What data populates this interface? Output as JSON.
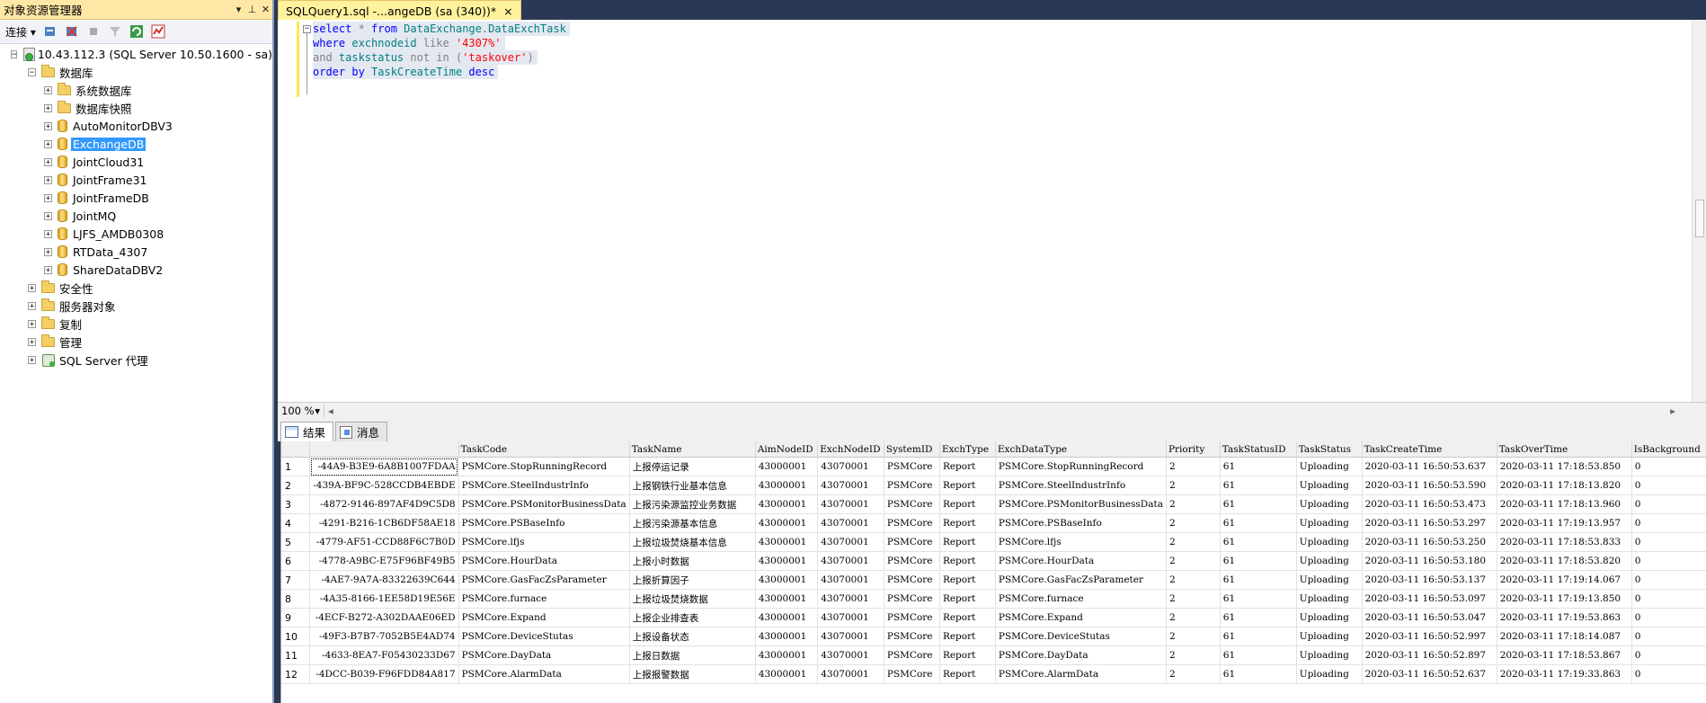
{
  "object_explorer": {
    "title": "对象资源管理器",
    "controls": [
      "▾",
      "⊥",
      "✕"
    ],
    "connect_label": "连接",
    "server": "10.43.112.3 (SQL Server 10.50.1600 - sa)",
    "databases_label": "数据库",
    "system_folders": [
      "系统数据库",
      "数据库快照"
    ],
    "databases": [
      "AutoMonitorDBV3",
      "ExchangeDB",
      "JointCloud31",
      "JointFrame31",
      "JointFrameDB",
      "JointMQ",
      "LJFS_AMDB0308",
      "RTData_4307",
      "ShareDataDBV2"
    ],
    "selected_database": "ExchangeDB",
    "server_folders": [
      "安全性",
      "服务器对象",
      "复制",
      "管理"
    ],
    "agent_label": "SQL Server 代理"
  },
  "document_tab": {
    "title": "SQLQuery1.sql -...angeDB (sa (340))*",
    "close": "×"
  },
  "editor": {
    "lines": [
      [
        {
          "t": "select",
          "c": "kw"
        },
        {
          "t": " * ",
          "c": "gr"
        },
        {
          "t": "from",
          "c": "kw"
        },
        {
          "t": " DataExchange",
          "c": "ob"
        },
        {
          "t": ".",
          "c": "gr"
        },
        {
          "t": "DataExchTask",
          "c": "ob"
        }
      ],
      [
        {
          "t": "where",
          "c": "kw"
        },
        {
          "t": " exchnodeid ",
          "c": "ob"
        },
        {
          "t": "like",
          "c": "gr"
        },
        {
          "t": " '4307%'",
          "c": "str"
        }
      ],
      [
        {
          "t": "and",
          "c": "gr"
        },
        {
          "t": " taskstatus ",
          "c": "ob"
        },
        {
          "t": "not in",
          "c": "gr"
        },
        {
          "t": " (",
          "c": "gr"
        },
        {
          "t": "'taskover'",
          "c": "str"
        },
        {
          "t": ")",
          "c": "gr"
        }
      ],
      [
        {
          "t": "order by",
          "c": "kw"
        },
        {
          "t": " TaskCreateTime ",
          "c": "ob"
        },
        {
          "t": "desc",
          "c": "kw"
        }
      ]
    ]
  },
  "zoom": {
    "value": "100 %"
  },
  "results": {
    "tabs": [
      "结果",
      "消息"
    ],
    "columns": [
      "",
      "",
      "TaskCode",
      "TaskName",
      "AimNodeID",
      "ExchNodeID",
      "SystemID",
      "ExchType",
      "ExchDataType",
      "Priority",
      "TaskStatusID",
      "TaskStatus",
      "TaskCreateTime",
      "TaskOverTime",
      "IsBackground"
    ],
    "rows": [
      [
        "1",
        "-44A9-B3E9-6A8B1007FDAA",
        "PSMCore.StopRunningRecord",
        "上报停运记录",
        "43000001",
        "43070001",
        "PSMCore",
        "Report",
        "PSMCore.StopRunningRecord",
        "2",
        "61",
        "Uploading",
        "2020-03-11 16:50:53.637",
        "2020-03-11 17:18:53.850",
        "0"
      ],
      [
        "2",
        "-439A-BF9C-528CCDB4EBDE",
        "PSMCore.SteelIndustrInfo",
        "上报钢铁行业基本信息",
        "43000001",
        "43070001",
        "PSMCore",
        "Report",
        "PSMCore.SteelIndustrInfo",
        "2",
        "61",
        "Uploading",
        "2020-03-11 16:50:53.590",
        "2020-03-11 17:18:13.820",
        "0"
      ],
      [
        "3",
        "-4872-9146-897AF4D9C5D8",
        "PSMCore.PSMonitorBusinessData",
        "上报污染源监控业务数据",
        "43000001",
        "43070001",
        "PSMCore",
        "Report",
        "PSMCore.PSMonitorBusinessData",
        "2",
        "61",
        "Uploading",
        "2020-03-11 16:50:53.473",
        "2020-03-11 17:18:13.960",
        "0"
      ],
      [
        "4",
        "-4291-B216-1CB6DF58AE18",
        "PSMCore.PSBaseInfo",
        "上报污染源基本信息",
        "43000001",
        "43070001",
        "PSMCore",
        "Report",
        "PSMCore.PSBaseInfo",
        "2",
        "61",
        "Uploading",
        "2020-03-11 16:50:53.297",
        "2020-03-11 17:19:13.957",
        "0"
      ],
      [
        "5",
        "-4779-AF51-CCD88F6C7B0D",
        "PSMCore.lfjs",
        "上报垃圾焚烧基本信息",
        "43000001",
        "43070001",
        "PSMCore",
        "Report",
        "PSMCore.lfjs",
        "2",
        "61",
        "Uploading",
        "2020-03-11 16:50:53.250",
        "2020-03-11 17:18:53.833",
        "0"
      ],
      [
        "6",
        "-4778-A9BC-E75F96BF49B5",
        "PSMCore.HourData",
        "上报小时数据",
        "43000001",
        "43070001",
        "PSMCore",
        "Report",
        "PSMCore.HourData",
        "2",
        "61",
        "Uploading",
        "2020-03-11 16:50:53.180",
        "2020-03-11 17:18:53.820",
        "0"
      ],
      [
        "7",
        "-4AE7-9A7A-83322639C644",
        "PSMCore.GasFacZsParameter",
        "上报折算因子",
        "43000001",
        "43070001",
        "PSMCore",
        "Report",
        "PSMCore.GasFacZsParameter",
        "2",
        "61",
        "Uploading",
        "2020-03-11 16:50:53.137",
        "2020-03-11 17:19:14.067",
        "0"
      ],
      [
        "8",
        "-4A35-8166-1EE58D19E56E",
        "PSMCore.furnace",
        "上报垃圾焚烧数据",
        "43000001",
        "43070001",
        "PSMCore",
        "Report",
        "PSMCore.furnace",
        "2",
        "61",
        "Uploading",
        "2020-03-11 16:50:53.097",
        "2020-03-11 17:19:13.850",
        "0"
      ],
      [
        "9",
        "-4ECF-B272-A302DAAE06ED",
        "PSMCore.Expand",
        "上报企业排查表",
        "43000001",
        "43070001",
        "PSMCore",
        "Report",
        "PSMCore.Expand",
        "2",
        "61",
        "Uploading",
        "2020-03-11 16:50:53.047",
        "2020-03-11 17:19:53.863",
        "0"
      ],
      [
        "10",
        "-49F3-B7B7-7052B5E4AD74",
        "PSMCore.DeviceStutas",
        "上报设备状态",
        "43000001",
        "43070001",
        "PSMCore",
        "Report",
        "PSMCore.DeviceStutas",
        "2",
        "61",
        "Uploading",
        "2020-03-11 16:50:52.997",
        "2020-03-11 17:18:14.087",
        "0"
      ],
      [
        "11",
        "-4633-8EA7-F05430233D67",
        "PSMCore.DayData",
        "上报日数据",
        "43000001",
        "43070001",
        "PSMCore",
        "Report",
        "PSMCore.DayData",
        "2",
        "61",
        "Uploading",
        "2020-03-11 16:50:52.897",
        "2020-03-11 17:18:53.867",
        "0"
      ],
      [
        "12",
        "-4DCC-B039-F96FDD84A817",
        "PSMCore.AlarmData",
        "上报报警数据",
        "43000001",
        "43070001",
        "PSMCore",
        "Report",
        "PSMCore.AlarmData",
        "2",
        "61",
        "Uploading",
        "2020-03-11 16:50:52.637",
        "2020-03-11 17:19:33.863",
        "0"
      ]
    ]
  }
}
